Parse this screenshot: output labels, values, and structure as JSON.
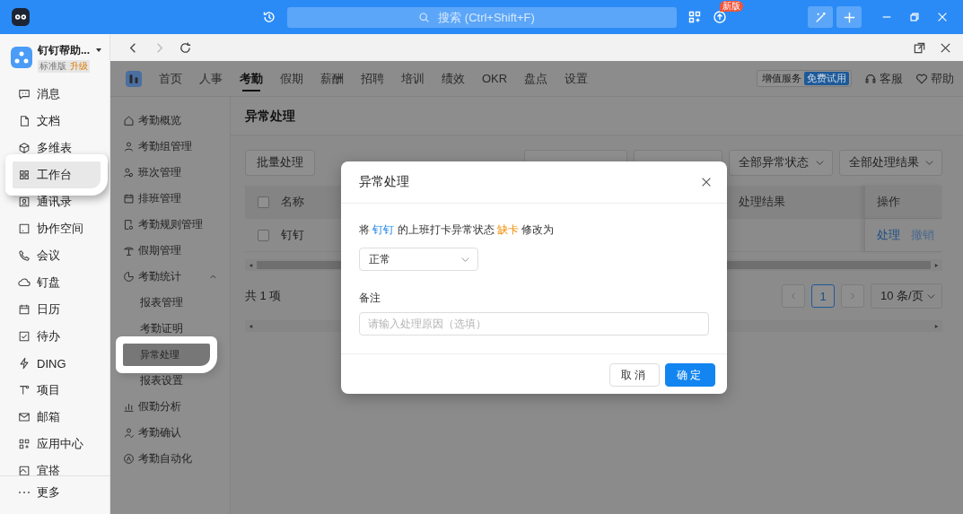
{
  "title_bar": {
    "search": {
      "placeholder": "搜索 (Ctrl+Shift+F)"
    },
    "update_badge": "新版"
  },
  "workspace": {
    "name": "钉钉帮助...",
    "edition": "标准版",
    "upgrade": "升级"
  },
  "sidebar": {
    "items": [
      {
        "label": "消息",
        "selected": false,
        "highlighted": false
      },
      {
        "label": "文档",
        "selected": false,
        "highlighted": false
      },
      {
        "label": "多维表",
        "selected": false,
        "highlighted": false
      },
      {
        "label": "工作台",
        "selected": true,
        "highlighted": true
      },
      {
        "label": "通讯录",
        "selected": false,
        "highlighted": false
      },
      {
        "label": "协作空间",
        "selected": false,
        "highlighted": false
      },
      {
        "label": "会议",
        "selected": false,
        "highlighted": false
      },
      {
        "label": "钉盘",
        "selected": false,
        "highlighted": false
      },
      {
        "label": "日历",
        "selected": false,
        "highlighted": false
      },
      {
        "label": "待办",
        "selected": false,
        "highlighted": false
      },
      {
        "label": "DING",
        "selected": false,
        "highlighted": false
      },
      {
        "label": "项目",
        "selected": false,
        "highlighted": false
      },
      {
        "label": "邮箱",
        "selected": false,
        "highlighted": false
      },
      {
        "label": "应用中心",
        "selected": false,
        "highlighted": false
      },
      {
        "label": "宜搭",
        "selected": false,
        "highlighted": false
      }
    ],
    "more": "更多"
  },
  "app_tabs": [
    {
      "label": "首页",
      "selected": false
    },
    {
      "label": "人事",
      "selected": false
    },
    {
      "label": "考勤",
      "selected": true
    },
    {
      "label": "假期",
      "selected": false
    },
    {
      "label": "薪酬",
      "selected": false
    },
    {
      "label": "招聘",
      "selected": false
    },
    {
      "label": "培训",
      "selected": false
    },
    {
      "label": "绩效",
      "selected": false
    },
    {
      "label": "OKR",
      "selected": false
    },
    {
      "label": "盘点",
      "selected": false
    },
    {
      "label": "设置",
      "selected": false
    }
  ],
  "header_actions": {
    "value_added": "增值服务",
    "trial": "免费试用",
    "service": "客服",
    "help": "帮助"
  },
  "menu": [
    {
      "label": "考勤概览",
      "selected": false
    },
    {
      "label": "考勤组管理",
      "selected": false
    },
    {
      "label": "班次管理",
      "selected": false
    },
    {
      "label": "排班管理",
      "selected": false
    },
    {
      "label": "考勤规则管理",
      "selected": false
    },
    {
      "label": "假期管理",
      "selected": false
    },
    {
      "label": "考勤统计",
      "selected": false,
      "expanded": true,
      "children": [
        {
          "label": "报表管理",
          "selected": false,
          "highlighted": false
        },
        {
          "label": "考勤证明",
          "selected": false,
          "highlighted": false
        },
        {
          "label": "异常处理",
          "selected": true,
          "highlighted": true
        },
        {
          "label": "报表设置",
          "selected": false,
          "highlighted": false
        }
      ]
    },
    {
      "label": "假勤分析",
      "selected": false
    },
    {
      "label": "考勤确认",
      "selected": false
    },
    {
      "label": "考勤自动化",
      "selected": false
    }
  ],
  "page": {
    "title": "异常处理",
    "batch_button": "批量处理",
    "filters": [
      {
        "value": "全部异常状态",
        "kind": "select"
      },
      {
        "value": "全部处理结果",
        "kind": "select"
      }
    ],
    "table": {
      "header_checked": false,
      "columns": [
        "名称",
        "处理结果",
        "操作"
      ],
      "rows": [
        {
          "name": "钉钉",
          "checked": false,
          "actions": [
            {
              "label": "处理",
              "disabled": false
            },
            {
              "label": "撤销",
              "disabled": true
            }
          ]
        }
      ]
    },
    "total": "共 1 项",
    "pages": [
      {
        "label": "1",
        "selected": true
      }
    ],
    "page_size": "10 条/页"
  },
  "dialog": {
    "title": "异常处理",
    "message": [
      {
        "text": "将 ",
        "kind": "plain"
      },
      {
        "text": "钉钉",
        "kind": "name"
      },
      {
        "text": " 的上班打卡异常状态 ",
        "kind": "plain"
      },
      {
        "text": "缺卡",
        "kind": "status"
      },
      {
        "text": " 修改为",
        "kind": "plain"
      }
    ],
    "status_select": "正常",
    "remark_label": "备注",
    "remark": {
      "placeholder": "请输入处理原因（选填）"
    },
    "buttons": [
      {
        "label": "取消",
        "kind": "secondary"
      },
      {
        "label": "确定",
        "kind": "primary"
      }
    ]
  }
}
